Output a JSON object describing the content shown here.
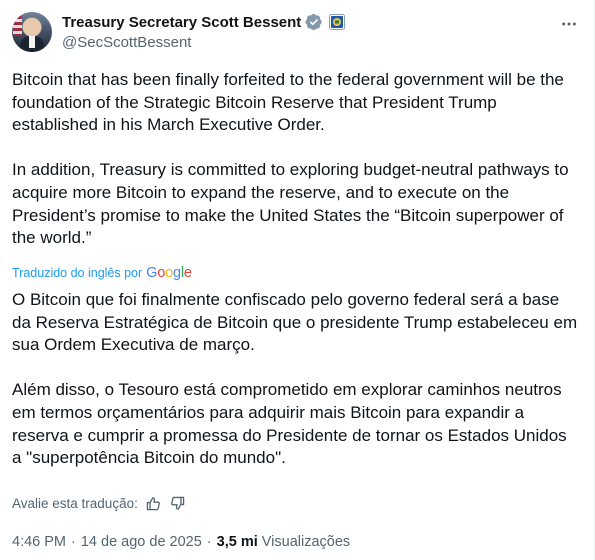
{
  "author": {
    "display_name": "Treasury Secretary Scott Bessent",
    "handle": "@SecScottBessent"
  },
  "icons": {
    "verified": "verified-badge-icon",
    "government": "us-government-affiliation-icon",
    "more": "more-options-icon",
    "thumbs_up": "thumbs-up-icon",
    "thumbs_down": "thumbs-down-icon"
  },
  "colors": {
    "accent": "#1d9bf0",
    "verified_badge": "#829aab",
    "text_primary": "#0f1419",
    "text_secondary": "#536471"
  },
  "post": {
    "original_text": "Bitcoin that has been finally forfeited to the federal government will be the foundation of the Strategic Bitcoin Reserve that President Trump established in his March Executive Order.\n\nIn addition, Treasury is committed to exploring budget-neutral pathways to acquire more Bitcoin to expand the reserve, and to execute on the President’s promise to make the United States the “Bitcoin superpower of the world.”",
    "translated_by_label": "Traduzido do inglês por",
    "translation_provider": "Google",
    "translated_text": "O Bitcoin que foi finalmente confiscado pelo governo federal será a base da Reserva Estratégica de Bitcoin que o presidente Trump estabeleceu em sua Ordem Executiva de março.\n\nAlém disso, o Tesouro está comprometido em explorar caminhos neutros em termos orçamentários para adquirir mais Bitcoin para expandir a reserva e cumprir a promessa do Presidente de tornar os Estados Unidos a \"superpotência Bitcoin do mundo\".",
    "rate_translation_label": "Avalie esta tradução:"
  },
  "meta": {
    "time": "4:46 PM",
    "separator": "·",
    "date": "14 de ago de 2025",
    "views_count": "3,5 mi",
    "views_label": "Visualizações"
  }
}
